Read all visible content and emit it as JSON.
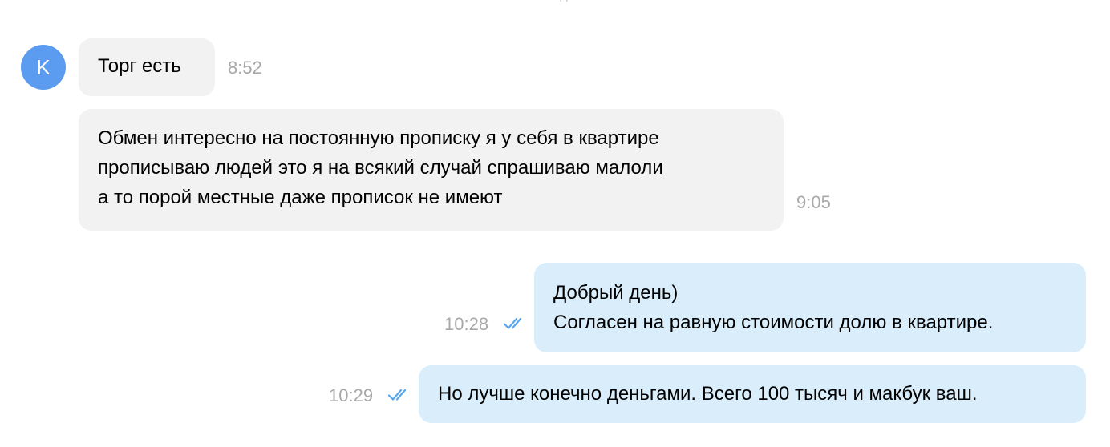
{
  "chat": {
    "top_fragment": "д",
    "contact": {
      "avatar_letter": "K",
      "avatar_color": "#5b9cf0"
    },
    "colors": {
      "incoming_bubble": "#f2f2f2",
      "outgoing_bubble": "#d9edfb",
      "read_check": "#58a6ee",
      "timestamp": "#a8a8a8"
    },
    "messages": [
      {
        "direction": "incoming",
        "lines": [
          "Торг есть"
        ],
        "time": "8:52"
      },
      {
        "direction": "incoming",
        "lines": [
          "Обмен интересно на постоянную прописку я у себя в квартире",
          "прописываю людей это я на всякий случай спрашиваю малоли",
          "а то порой местные даже прописок не имеют"
        ],
        "time": "9:05"
      },
      {
        "direction": "outgoing",
        "lines": [
          "Добрый день)",
          "Согласен на равную стоимости долю в квартире."
        ],
        "time": "10:28",
        "status_icon": "double-check-icon"
      },
      {
        "direction": "outgoing",
        "lines": [
          "Но лучше конечно деньгами. Всего 100 тысяч и макбук ваш."
        ],
        "time": "10:29",
        "status_icon": "double-check-icon"
      }
    ]
  }
}
